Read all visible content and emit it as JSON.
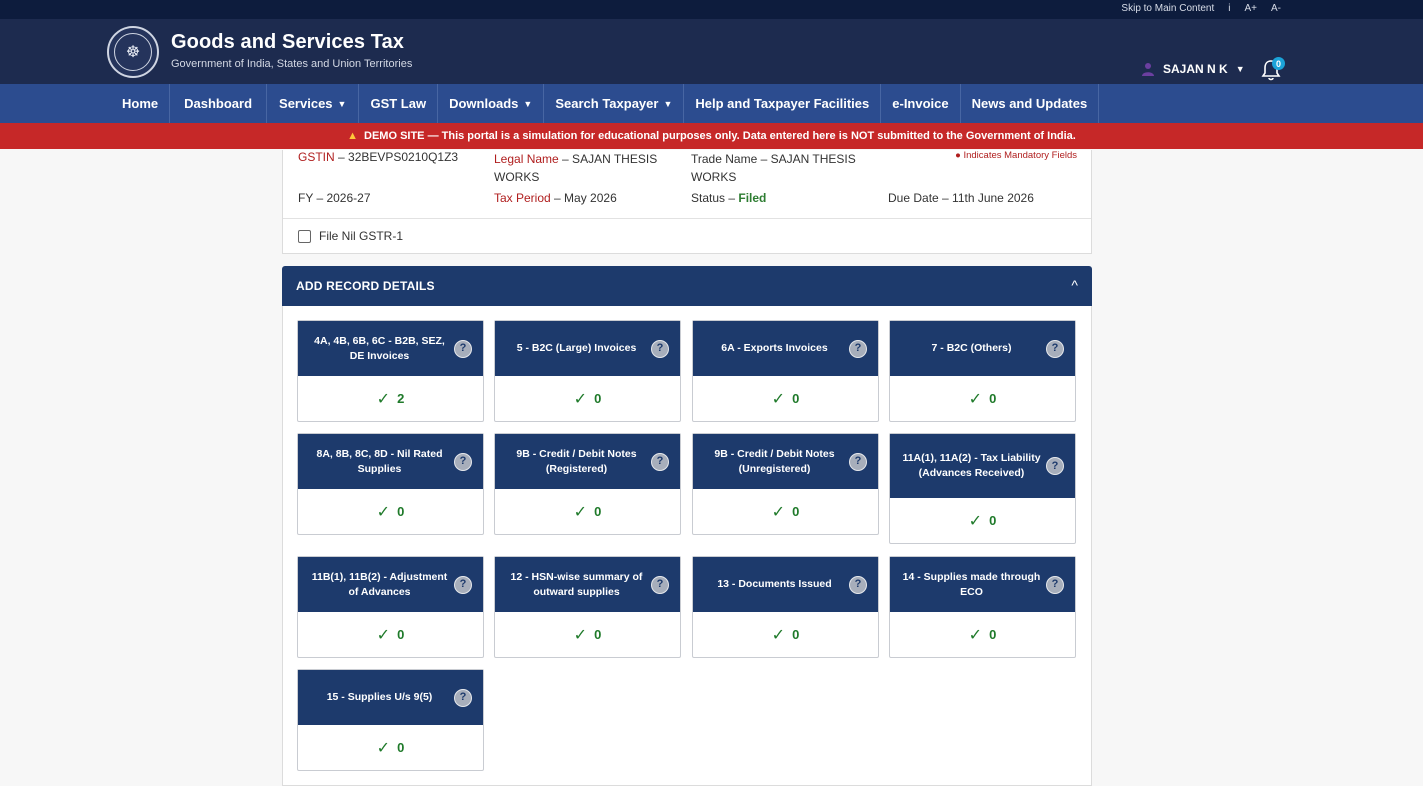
{
  "topstrip": {
    "skip": "Skip to Main Content",
    "info": "i",
    "a_plus": "A+",
    "a_minus": "A-"
  },
  "header": {
    "logo_text": "☸",
    "title": "Goods and Services Tax",
    "subtitle": "Government of India, States and Union Territories",
    "user": "SAJAN N K",
    "user_caret": "▼",
    "notif_count": "0"
  },
  "nav": {
    "items": [
      {
        "label": "Home",
        "caret": ""
      },
      {
        "label": "Dashboard",
        "caret": ""
      },
      {
        "label": "Services",
        "caret": "▼"
      },
      {
        "label": "GST Law",
        "caret": ""
      },
      {
        "label": "Downloads",
        "caret": "▼"
      },
      {
        "label": "Search Taxpayer",
        "caret": "▼"
      },
      {
        "label": "Help and Taxpayer Facilities",
        "caret": ""
      },
      {
        "label": "e-Invoice",
        "caret": ""
      },
      {
        "label": "News and Updates",
        "caret": ""
      }
    ]
  },
  "demo": {
    "icon": "▲",
    "text": "DEMO SITE — This portal is a simulation for educational purposes only. Data entered here is NOT submitted to the Government of India."
  },
  "info": {
    "gstin_label": "GSTIN",
    "gstin_value": " – 32BEVPS0210Q1Z3",
    "legal_label": "Legal Name",
    "legal_value_1": " – SAJAN THESIS",
    "legal_value_2": "WORKS",
    "trade_label": "Trade Name – SAJAN THESIS",
    "trade_value_2": "WORKS",
    "mandatory": "● Indicates Mandatory Fields",
    "fy": "FY – 2026-27",
    "tax_period_label": "Tax Period",
    "tax_period_value": " – May 2026",
    "status_label": "Status – ",
    "status_value": "Filed",
    "due_date": "Due Date – 11th June 2026",
    "nil_label": "File Nil GSTR-1"
  },
  "records": {
    "title": "ADD RECORD DETAILS",
    "collapse": "^",
    "help": "?",
    "tick": "✓",
    "cards": [
      {
        "title": "4A, 4B, 6B, 6C - B2B, SEZ, DE Invoices",
        "count": "2"
      },
      {
        "title": "5 - B2C (Large) Invoices",
        "count": "0"
      },
      {
        "title": "6A - Exports Invoices",
        "count": "0"
      },
      {
        "title": "7 - B2C (Others)",
        "count": "0"
      },
      {
        "title": "8A, 8B, 8C, 8D - Nil Rated Supplies",
        "count": "0"
      },
      {
        "title": "9B - Credit / Debit Notes (Registered)",
        "count": "0"
      },
      {
        "title": "9B - Credit / Debit Notes (Unregistered)",
        "count": "0"
      },
      {
        "title": "11A(1), 11A(2) - Tax Liability (Advances Received)",
        "count": "0"
      },
      {
        "title": "11B(1), 11B(2) - Adjustment of Advances",
        "count": "0"
      },
      {
        "title": "12 - HSN-wise summary of outward supplies",
        "count": "0"
      },
      {
        "title": "13 - Documents Issued",
        "count": "0"
      },
      {
        "title": "14 - Supplies made through ECO",
        "count": "0"
      },
      {
        "title": "15 - Supplies U/s 9(5)",
        "count": "0"
      }
    ]
  },
  "colors": {
    "header": "#1d2b4f",
    "nav": "#2c4c8f",
    "banner": "#c62828",
    "card_header": "#1d3a6c",
    "tick": "#1f7a2a"
  }
}
